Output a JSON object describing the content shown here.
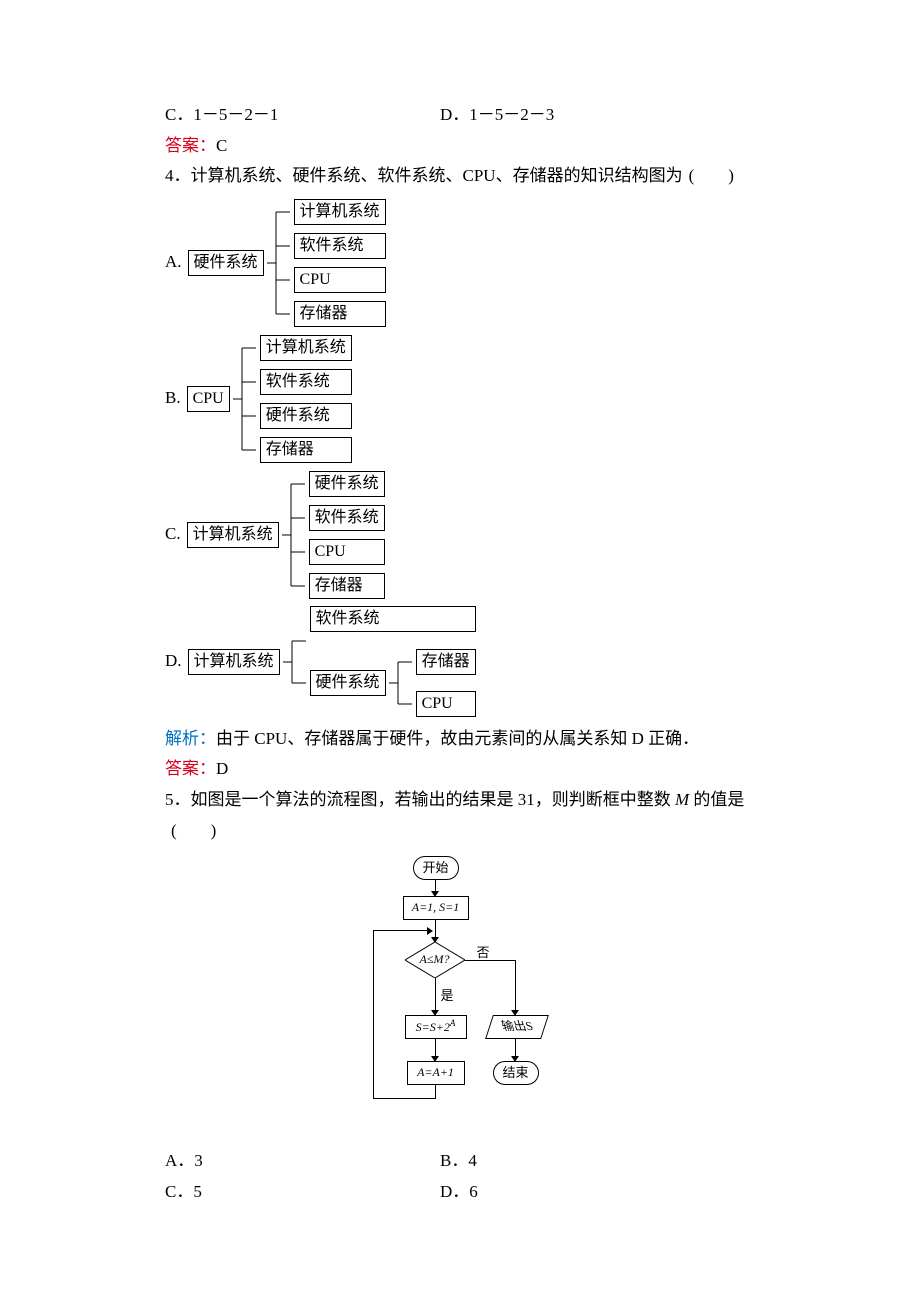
{
  "q3": {
    "optC_label": "C．",
    "optC_text": "1－5－2－1",
    "optD_label": "D．",
    "optD_text": "1－5－2－3",
    "answer_label": "答案：",
    "answer_value": "C"
  },
  "q4": {
    "stem_prefix": "4．",
    "stem": "计算机系统、硬件系统、软件系统、CPU、存储器的知识结构图为",
    "paren": "(　　)",
    "A": {
      "letter": "A.",
      "root": "硬件系统",
      "items": [
        "计算机系统",
        "软件系统",
        "CPU",
        "存储器"
      ]
    },
    "B": {
      "letter": "B.",
      "root": "CPU",
      "items": [
        "计算机系统",
        "软件系统",
        "硬件系统",
        "存储器"
      ]
    },
    "C": {
      "letter": "C.",
      "root": "计算机系统",
      "items": [
        "硬件系统",
        "软件系统",
        "CPU",
        "存储器"
      ]
    },
    "D": {
      "letter": "D.",
      "root": "计算机系统",
      "level1": [
        "软件系统",
        "硬件系统"
      ],
      "level2": [
        "存储器",
        "CPU"
      ]
    },
    "analysis_label": "解析：",
    "analysis_text": "由于 CPU、存储器属于硬件，故由元素间的从属关系知 D 正确．",
    "answer_label": "答案：",
    "answer_value": "D"
  },
  "q5": {
    "stem_prefix": "5．",
    "stem_part1": "如图是一个算法的流程图，若输出的结果是 31，则判断框中整数 ",
    "var": "M",
    "stem_part2": " 的值是",
    "paren": "(　　)",
    "flow": {
      "start": "开始",
      "init": "A=1, S=1",
      "cond": "A≤M?",
      "no": "否",
      "yes": "是",
      "s_update": "S=S+2",
      "s_exp": "A",
      "a_update": "A=A+1",
      "output": "输出S",
      "end": "结束"
    },
    "opts": {
      "A_label": "A．",
      "A": "3",
      "B_label": "B．",
      "B": "4",
      "C_label": "C．",
      "C": "5",
      "D_label": "D．",
      "D": "6"
    }
  }
}
